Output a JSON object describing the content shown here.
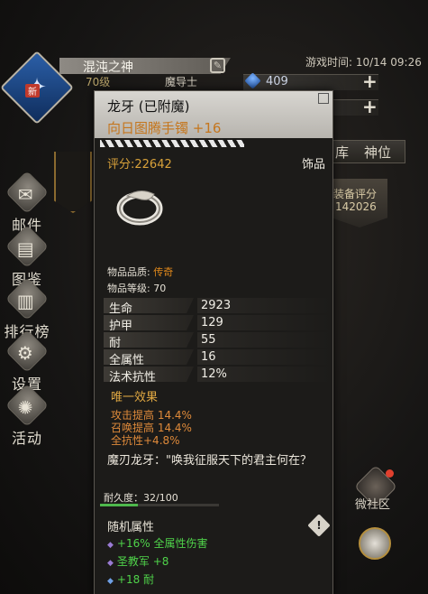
{
  "player": {
    "name": "混沌之神",
    "level": "70级",
    "class": "魔导士",
    "new_badge": "新",
    "gem_count": "409"
  },
  "game_time": "游戏时间: 10/14 09:26",
  "side_menu": [
    {
      "label": "邮件"
    },
    {
      "label": "图鉴"
    },
    {
      "label": "排行榜"
    },
    {
      "label": "设置"
    },
    {
      "label": "活动"
    }
  ],
  "tabs": {
    "library": "库",
    "position": "神位"
  },
  "equip_score": {
    "label": "装备评分",
    "value": "142026"
  },
  "community": {
    "label": "微社区"
  },
  "tooltip": {
    "name": "龙牙 (已附魔)",
    "item": "向日图腾手镯 +16",
    "score": "评分:22642",
    "type": "饰品",
    "quality_label": "物品品质: ",
    "quality_value": "传奇",
    "item_level": "物品等级: 70",
    "stats": [
      {
        "k": "生命",
        "v": "2923"
      },
      {
        "k": "护甲",
        "v": "129"
      },
      {
        "k": "耐",
        "v": "55"
      },
      {
        "k": "全属性",
        "v": "16"
      },
      {
        "k": "法术抗性",
        "v": "12%"
      }
    ],
    "unique_title": "唯一效果",
    "unique_effects": [
      "攻击提高 14.4%",
      "召唤提高 14.4%",
      "全抗性+4.8%"
    ],
    "quote": "魔刃龙牙：\"唤我征服天下的君主何在？",
    "durability": "耐久度：32/100",
    "durability_fraction": 0.32,
    "random_title": "随机属性",
    "random_attrs": [
      {
        "text": "+16% 全属性伤害"
      },
      {
        "text": "圣教军 +8"
      },
      {
        "text": "+18 耐"
      }
    ]
  },
  "colors": {
    "legendary": "#e38a1b",
    "score": "#d9a23a",
    "random_attr": "#4fd34a",
    "durability": "#4eb84c"
  }
}
